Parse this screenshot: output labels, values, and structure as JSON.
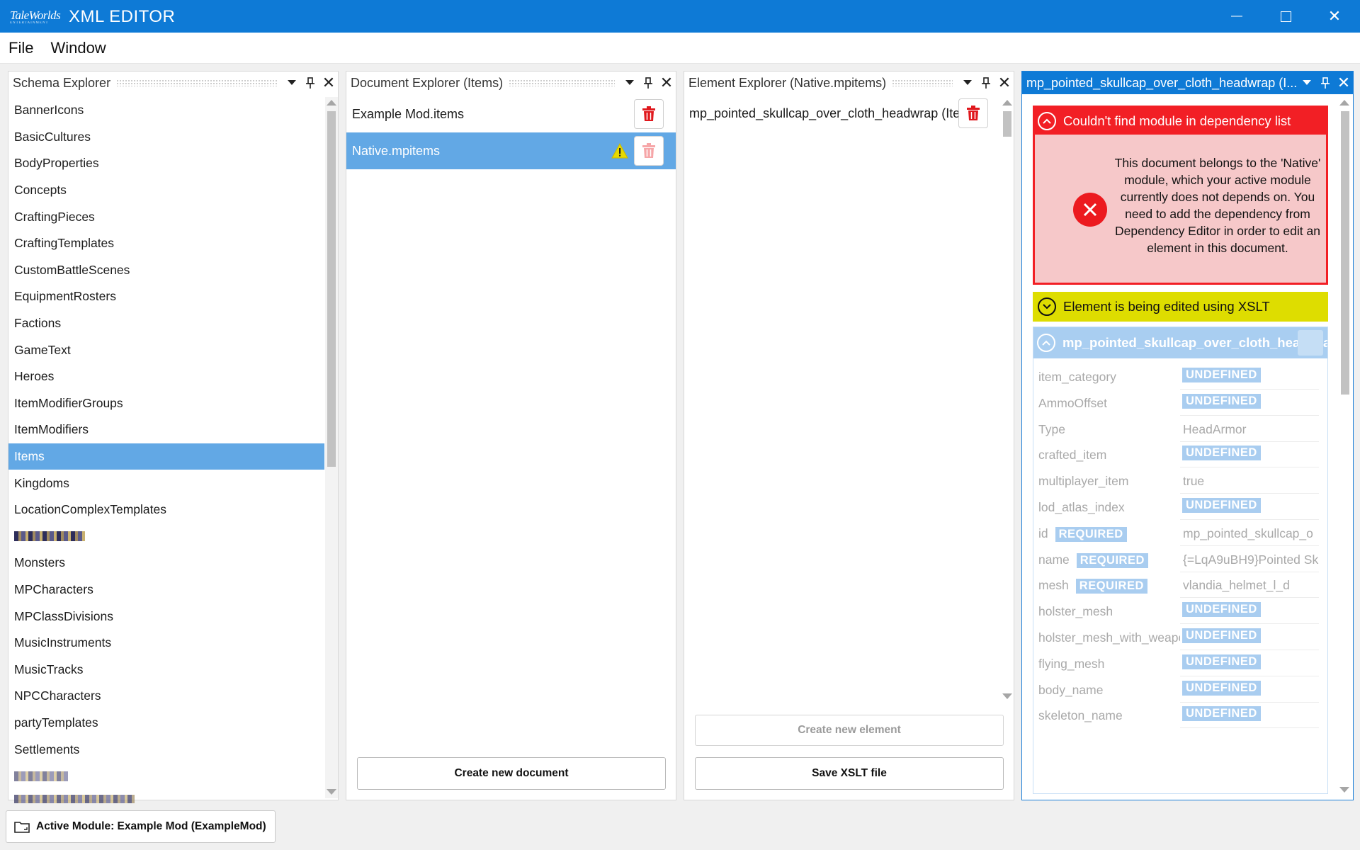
{
  "window": {
    "logo_text": "TaleWorlds",
    "logo_sub": "ENTERTAINMENT",
    "title": "XML EDITOR",
    "minimize": "—",
    "maximize": "☐",
    "close": "✕"
  },
  "menu": [
    "File",
    "Window"
  ],
  "schema_explorer": {
    "title": "Schema Explorer",
    "items": [
      "BannerIcons",
      "BasicCultures",
      "BodyProperties",
      "Concepts",
      "CraftingPieces",
      "CraftingTemplates",
      "CustomBattleScenes",
      "EquipmentRosters",
      "Factions",
      "GameText",
      "Heroes",
      "ItemModifierGroups",
      "ItemModifiers",
      "Items",
      "Kingdoms",
      "LocationComplexTemplates",
      "",
      "Monsters",
      "MPCharacters",
      "MPClassDivisions",
      "MusicInstruments",
      "MusicTracks",
      "NPCCharacters",
      "partyTemplates",
      "Settlements",
      "",
      ""
    ],
    "selected": "Items"
  },
  "document_explorer": {
    "title": "Document Explorer (Items)",
    "documents": [
      "Example Mod.items",
      "Native.mpitems"
    ],
    "selected": "Native.mpitems",
    "create_button": "Create new document"
  },
  "element_explorer": {
    "title": "Element Explorer (Native.mpitems)",
    "elements": [
      "mp_pointed_skullcap_over_cloth_headwrap (Item)"
    ],
    "create_button": "Create new element",
    "save_button": "Save XSLT file"
  },
  "element_editor": {
    "title": "mp_pointed_skullcap_over_cloth_headwrap (I...",
    "error_title": "Couldn't find module in dependency list",
    "error_message": "This document belongs to the 'Native' module, which your active module currently does not depends on. You need to add the dependency from Dependency Editor in order to edit an element in this document.",
    "xslt_notice": "Element is being edited using XSLT",
    "element_name": "mp_pointed_skullcap_over_cloth_headwrap",
    "attributes": [
      {
        "name": "item_category",
        "value": "UNDEFINED",
        "undefined": true,
        "required": false
      },
      {
        "name": "AmmoOffset",
        "value": "UNDEFINED",
        "undefined": true,
        "required": false
      },
      {
        "name": "Type",
        "value": "HeadArmor",
        "undefined": false,
        "required": false
      },
      {
        "name": "crafted_item",
        "value": "UNDEFINED",
        "undefined": true,
        "required": false
      },
      {
        "name": "multiplayer_item",
        "value": "true",
        "undefined": false,
        "required": false
      },
      {
        "name": "lod_atlas_index",
        "value": "UNDEFINED",
        "undefined": true,
        "required": false
      },
      {
        "name": "id",
        "value": "mp_pointed_skullcap_o",
        "undefined": false,
        "required": true
      },
      {
        "name": "name",
        "value": "{=LqA9uBH9}Pointed Sk",
        "undefined": false,
        "required": true
      },
      {
        "name": "mesh",
        "value": "vlandia_helmet_l_d",
        "undefined": false,
        "required": true
      },
      {
        "name": "holster_mesh",
        "value": "UNDEFINED",
        "undefined": true,
        "required": false
      },
      {
        "name": "holster_mesh_with_weapon",
        "value": "UNDEFINED",
        "undefined": true,
        "required": false
      },
      {
        "name": "flying_mesh",
        "value": "UNDEFINED",
        "undefined": true,
        "required": false
      },
      {
        "name": "body_name",
        "value": "UNDEFINED",
        "undefined": true,
        "required": false
      },
      {
        "name": "skeleton_name",
        "value": "UNDEFINED",
        "undefined": true,
        "required": false
      }
    ],
    "required_label": "REQUIRED"
  },
  "status": {
    "active_module": "Active Module: Example Mod (ExampleMod)"
  },
  "colors": {
    "accent": "#0e7ad6",
    "selection": "#62a8e5",
    "error": "#f21f25",
    "error_bg": "#f6c8c9",
    "xslt": "#dedd00",
    "undefined_tag": "#a9cdf0"
  },
  "icons": [
    "taleworlds-logo",
    "minimize-icon",
    "maximize-icon",
    "close-icon",
    "dropdown-icon",
    "pin-icon",
    "close-panel-icon",
    "trash-icon",
    "warning-icon",
    "collapse-icon",
    "expand-icon",
    "error-icon",
    "folder-icon"
  ]
}
